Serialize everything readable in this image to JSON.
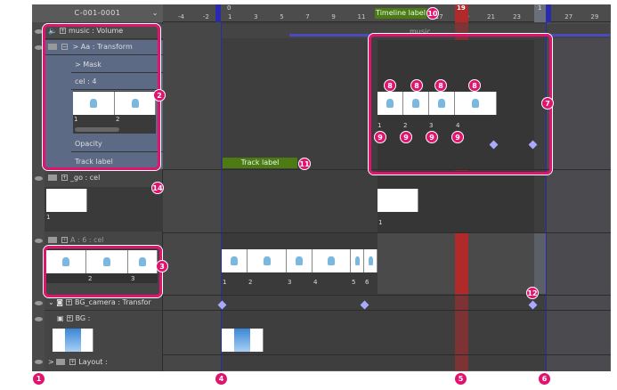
{
  "header": {
    "composition": "C-001-0001"
  },
  "ruler": {
    "frames": [
      -4,
      -2,
      1,
      3,
      5,
      7,
      9,
      11,
      13,
      15,
      17,
      19,
      21,
      23,
      25,
      27,
      29
    ],
    "start_mark": "0",
    "current_frame": "19",
    "end_mark": "1",
    "timeline_label": "Timeline label"
  },
  "tracks": {
    "music": "music : Volume",
    "aa": "Aa : Transform",
    "mask": "Mask",
    "cel": "cel : 4",
    "cel_nums": [
      "1",
      "2"
    ],
    "opacity": "Opacity",
    "track_label": "Track label",
    "go": "_go : cel",
    "go_num": "1",
    "a": "A : 6 : cel",
    "a_nums": [
      "2",
      "3"
    ],
    "bgcam": "BG_camera : Transfor",
    "bg": "BG :",
    "layout": "Layout :"
  },
  "timeline": {
    "music_clip": "music",
    "track_label_clip": "Track label",
    "go_num": "1",
    "a_nums": [
      "1",
      "2",
      "3",
      "4",
      "5",
      "6"
    ],
    "cel4_nums": [
      "1",
      "2",
      "3",
      "4"
    ]
  },
  "callouts": [
    "1",
    "2",
    "3",
    "4",
    "5",
    "6",
    "7",
    "8",
    "9",
    "10",
    "11",
    "12",
    "14"
  ],
  "colors": {
    "accent": "#e0146e",
    "playhead": "#b02a2a",
    "keyframe": "#a9a9ff",
    "label": "#4d7a12",
    "range": "#2a2ab0"
  }
}
